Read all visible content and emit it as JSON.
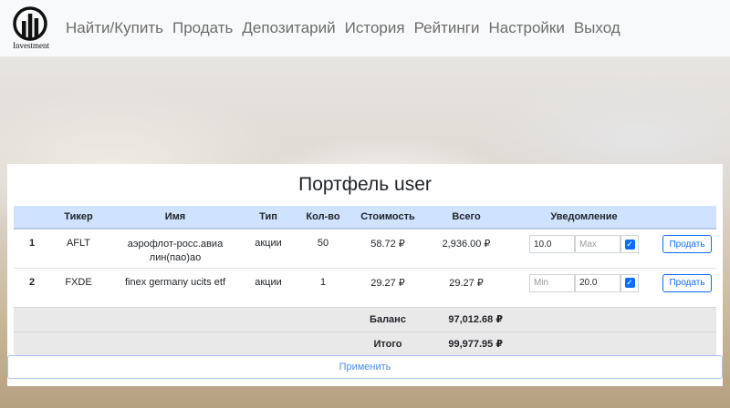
{
  "brand": {
    "logo_text": "Investment"
  },
  "nav": [
    {
      "label": "Найти/Купить"
    },
    {
      "label": "Продать"
    },
    {
      "label": "Депозитарий"
    },
    {
      "label": "История"
    },
    {
      "label": "Рейтинги"
    },
    {
      "label": "Настройки"
    },
    {
      "label": "Выход"
    }
  ],
  "portfolio": {
    "title": "Портфель user",
    "headers": [
      "",
      "Тикер",
      "Имя",
      "Тип",
      "Кол-во",
      "Стоимость",
      "Всего",
      "Уведомление",
      ""
    ],
    "rows": [
      {
        "index": "1",
        "ticker": "AFLT",
        "name": "аэрофлот-росс.авиалин(пао)ао",
        "type": "акции",
        "qty": "50",
        "price": "58.72 ₽",
        "total": "2,936.00 ₽",
        "notify_min": {
          "value": "10.0",
          "placeholder": "Min"
        },
        "notify_max": {
          "value": "",
          "placeholder": "Max"
        },
        "notify_checked": true,
        "sell_label": "Продать"
      },
      {
        "index": "2",
        "ticker": "FXDE",
        "name": "finex germany ucits etf",
        "type": "акции",
        "qty": "1",
        "price": "29.27 ₽",
        "total": "29.27 ₽",
        "notify_min": {
          "value": "",
          "placeholder": "Min"
        },
        "notify_max": {
          "value": "20.0",
          "placeholder": "Max"
        },
        "notify_checked": true,
        "sell_label": "Продать"
      }
    ],
    "balance": {
      "label": "Баланс",
      "value": "97,012.68 ₽"
    },
    "total": {
      "label": "Итого",
      "value": "99,977.95 ₽"
    },
    "apply_label": "Применить"
  },
  "colors": {
    "accent": "#0d6efd",
    "header_bg": "#cfe2ff",
    "summary_bg": "#e9e9ea"
  },
  "icons": {
    "logo": "bar-chart-circle-icon",
    "checkbox": "checkmark-icon"
  }
}
